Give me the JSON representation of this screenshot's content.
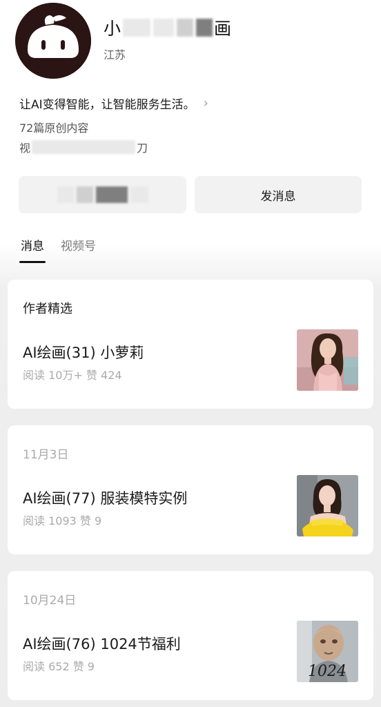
{
  "profile": {
    "name_start": "小",
    "name_end": "画",
    "location": "江苏",
    "bio": "让AI变得智能，让智能服务生活。",
    "original_count": "72篇原创内容",
    "row3_start": "视",
    "row3_end": "刀"
  },
  "buttons": {
    "message_label": "发消息"
  },
  "tabs": [
    {
      "label": "消息",
      "active": true
    },
    {
      "label": "视频号",
      "active": false
    }
  ],
  "featured": {
    "header": "作者精选",
    "article": {
      "title": "AI绘画(31) 小萝莉",
      "meta": "阅读 10万+  赞 424",
      "thumb_icon": "portrait-girl-pink"
    }
  },
  "posts": [
    {
      "date": "11月3日",
      "title": "AI绘画(77) 服装模特实例",
      "meta": "阅读 1093  赞 9",
      "thumb_icon": "portrait-model-yellow"
    },
    {
      "date": "10月24日",
      "title": "AI绘画(76) 1024节福利",
      "meta": "阅读 652  赞 9",
      "thumb_icon": "portrait-old-man-1024",
      "thumb_text": "1024"
    }
  ],
  "colors": {
    "avatar_bg": "#2b1414",
    "card_bg": "#ffffff",
    "button_bg": "#f2f2f2"
  }
}
